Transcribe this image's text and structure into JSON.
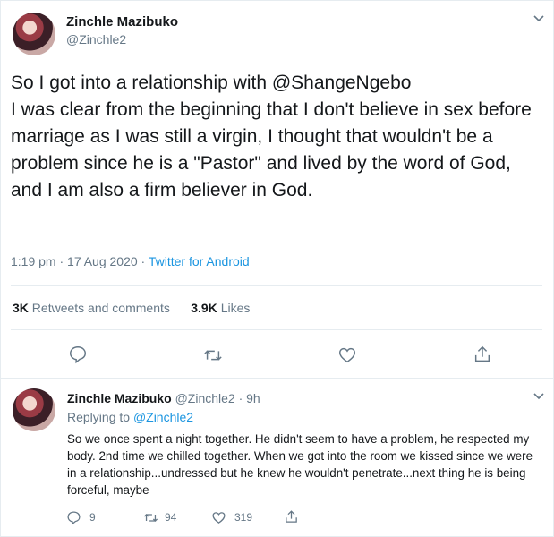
{
  "tweet": {
    "author_name": "Zinchle Mazibuko",
    "author_handle": "@Zinchle2",
    "text": "So I got into a relationship with @ShangeNgebo\nI was clear from the beginning that I don't believe in sex before marriage as I was still a virgin, I thought that wouldn't be a problem since he is a \"Pastor\" and lived by the word of God, and I am also a firm  believer in God.",
    "time": "1:19 pm · 17 Aug 2020 · ",
    "source": "Twitter for Android",
    "retweets_count": "3K",
    "retweets_label": "Retweets and comments",
    "likes_count": "3.9K",
    "likes_label": "Likes"
  },
  "reply": {
    "author_name": "Zinchle Mazibuko",
    "handle_time": "@Zinchle2 · 9h",
    "replying_prefix": "Replying to ",
    "replying_to": "@Zinchle2",
    "text": "So we once spent a night together.  He didn't seem to have a problem, he respected my body.  2nd time we chilled together.  When we got into the room we kissed since we were in a relationship...undressed but he knew he wouldn't penetrate...next thing he is being forceful, maybe",
    "reply_count": "9",
    "retweet_count": "94",
    "like_count": "319"
  },
  "colors": {
    "link": "#1b95e0",
    "muted": "#657786",
    "text": "#14171a",
    "border": "#e6ecf0"
  },
  "icons": [
    "chevron-down-icon",
    "reply-icon",
    "retweet-icon",
    "share-icon",
    "like-icon"
  ]
}
